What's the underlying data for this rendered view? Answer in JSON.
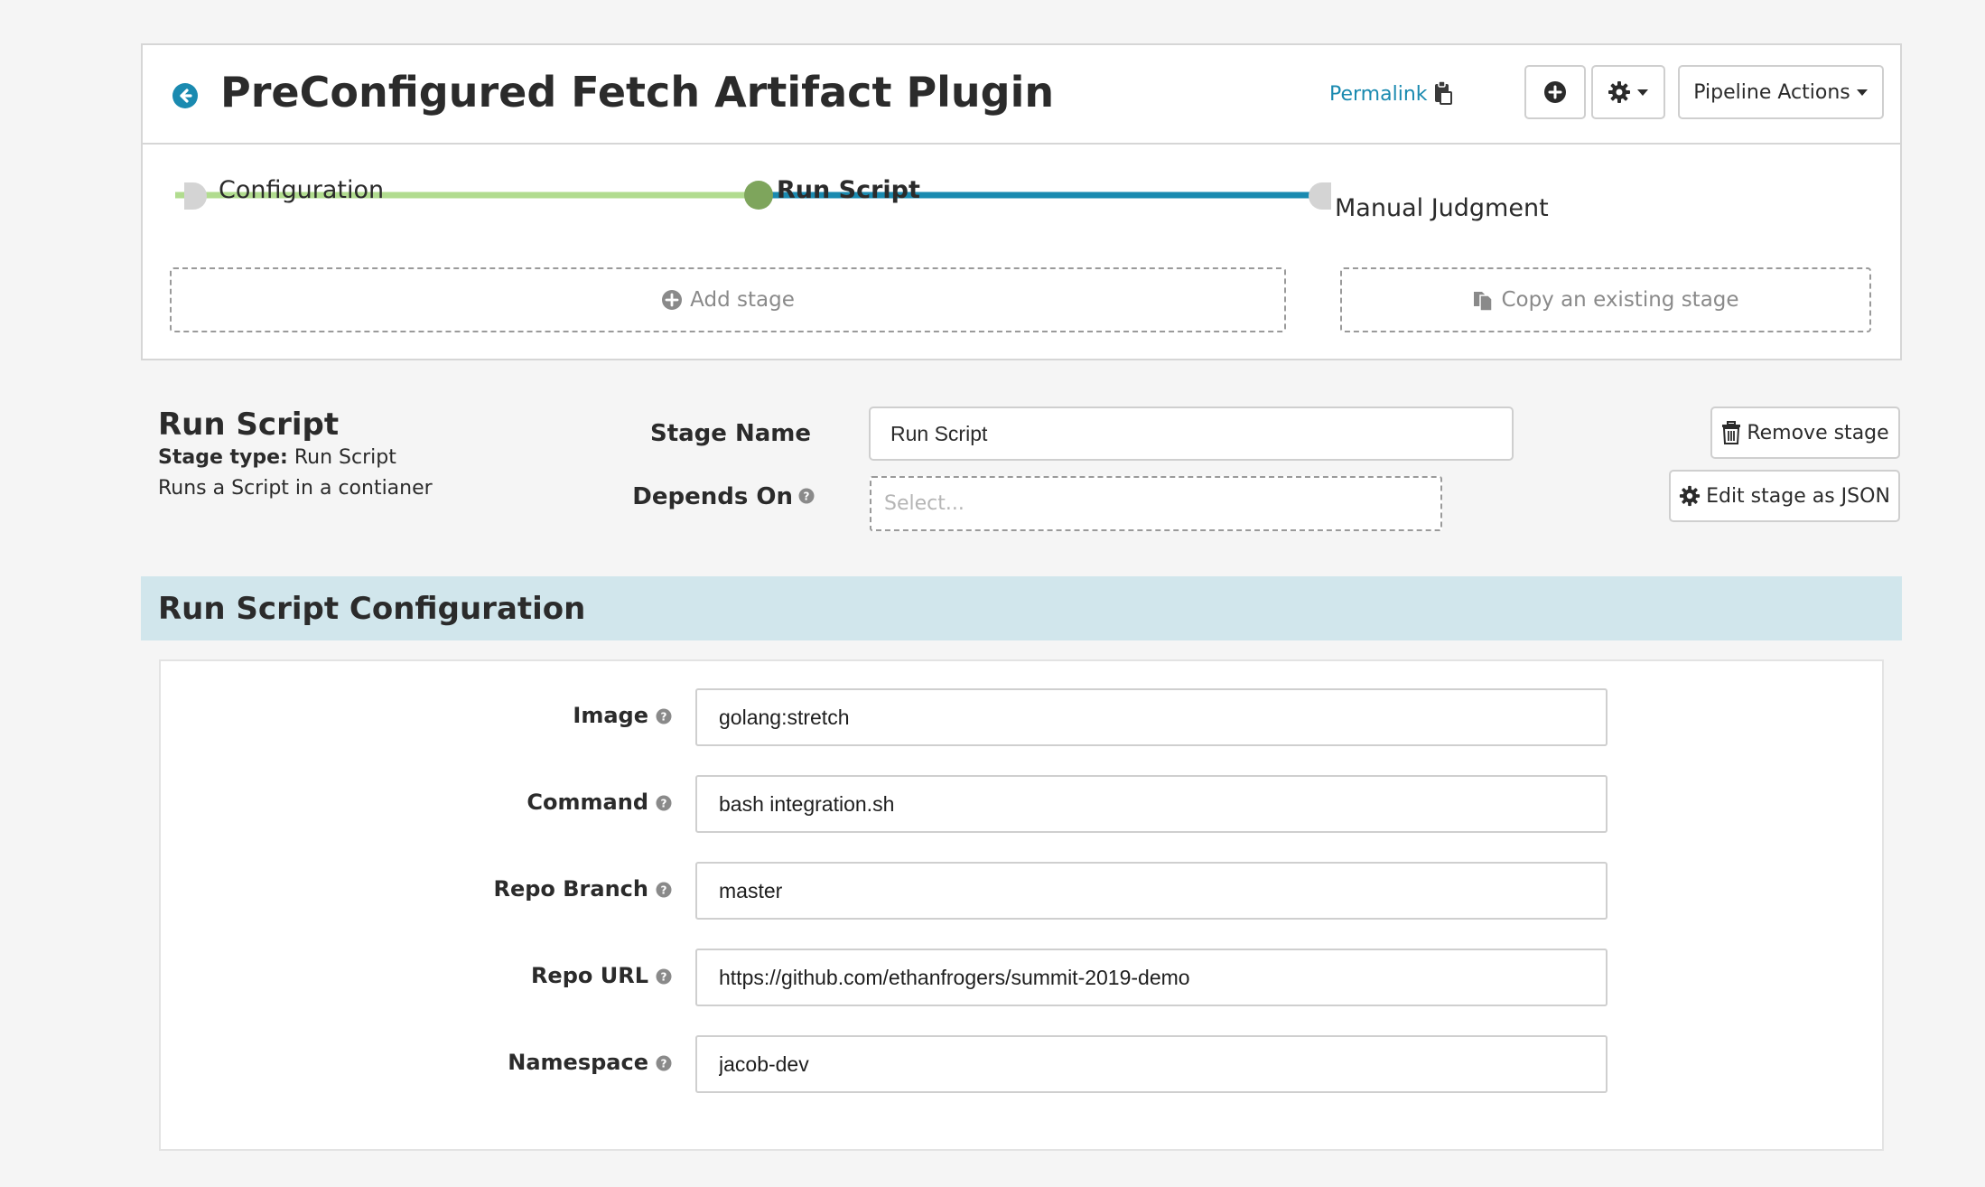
{
  "header": {
    "title": "PreConfigured Fetch Artifact Plugin",
    "permalink_label": "Permalink",
    "pipeline_actions_label": "Pipeline Actions",
    "accent_color": "#1a8ab0"
  },
  "graph": {
    "nodes": [
      {
        "label": "Configuration",
        "status": "complete"
      },
      {
        "label": "Run Script",
        "status": "selected"
      },
      {
        "label": "Manual Judgment",
        "status": "pending"
      }
    ],
    "edge_colors": {
      "complete": "#b1dc8f",
      "active": "#1a8ab0",
      "node_active": "#7ea55c",
      "node_idle": "#d4d4d4"
    }
  },
  "stage_actions": {
    "add_stage_label": "Add stage",
    "copy_stage_label": "Copy an existing stage"
  },
  "stage": {
    "title": "Run Script",
    "type_label": "Stage type:",
    "type_value": "Run Script",
    "description": "Runs a Script in a contianer",
    "stage_name_label": "Stage Name",
    "stage_name_value": "Run Script",
    "depends_on_label": "Depends On",
    "depends_on_placeholder": "Select...",
    "remove_label": "Remove stage",
    "edit_json_label": "Edit stage as JSON"
  },
  "config": {
    "title": "Run Script Configuration",
    "fields": [
      {
        "label": "Image",
        "value": "golang:stretch"
      },
      {
        "label": "Command",
        "value": "bash integration.sh"
      },
      {
        "label": "Repo Branch",
        "value": "master"
      },
      {
        "label": "Repo URL",
        "value": "https://github.com/ethanfrogers/summit-2019-demo"
      },
      {
        "label": "Namespace",
        "value": "jacob-dev"
      }
    ]
  },
  "icons": [
    "back-arrow-icon",
    "clipboard-icon",
    "plus-circle-icon",
    "gear-icon",
    "caret-down-icon",
    "copy-icon",
    "trash-icon",
    "help-circle-icon"
  ]
}
